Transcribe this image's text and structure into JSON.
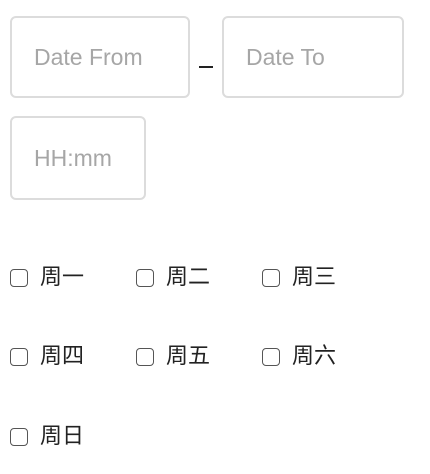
{
  "date_range": {
    "from_placeholder": "Date From",
    "from_value": "",
    "separator": "–",
    "to_placeholder": "Date To",
    "to_value": ""
  },
  "time": {
    "placeholder": "HH:mm",
    "value": ""
  },
  "weekdays": [
    {
      "label": "周一",
      "checked": false
    },
    {
      "label": "周二",
      "checked": false
    },
    {
      "label": "周三",
      "checked": false
    },
    {
      "label": "周四",
      "checked": false
    },
    {
      "label": "周五",
      "checked": false
    },
    {
      "label": "周六",
      "checked": false
    },
    {
      "label": "周日",
      "checked": false
    }
  ]
}
